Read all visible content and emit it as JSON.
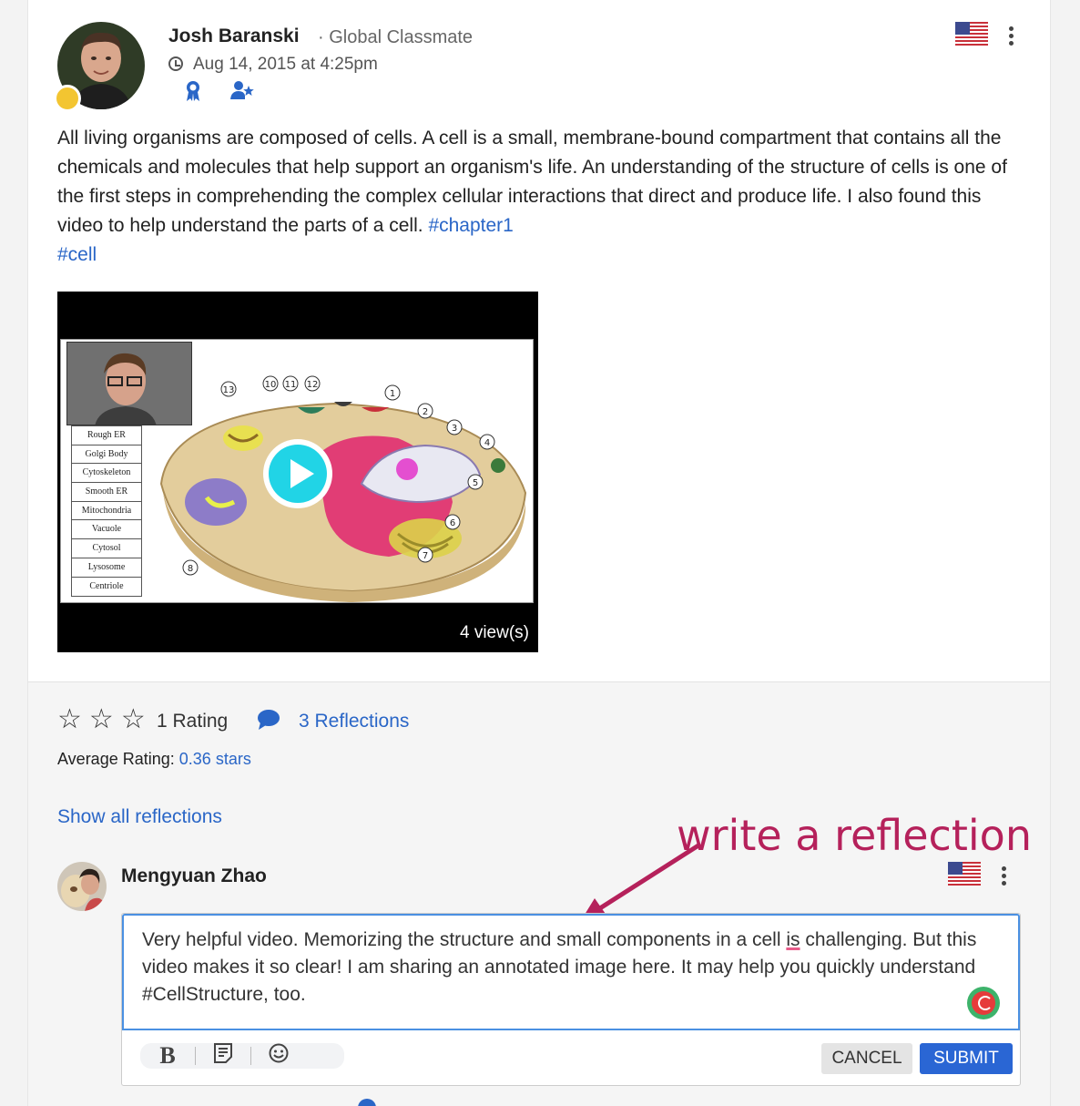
{
  "post": {
    "author": "Josh Baranski",
    "role": "· Global Classmate",
    "date": "Aug 14, 2015 at 4:25pm",
    "text": "All living organisms are composed of cells. A cell is a small, membrane-bound compartment that contains all the chemicals and molecules that help support an organism's life. An understanding of the structure of cells is one of the first steps in comprehending the complex cellular interactions that direct and produce life. I also found this video to help understand the parts of a cell. ",
    "hashtag1": "#chapter1",
    "hashtag2": "#cell",
    "video": {
      "views": "4 view(s)",
      "legend": [
        "Rough ER",
        "Golgi Body",
        "Cytoskeleton",
        "Smooth ER",
        "Mitochondria",
        "Vacuole",
        "Cytosol",
        "Lysosome",
        "Centriole"
      ],
      "numbers": [
        "1",
        "2",
        "3",
        "4",
        "5",
        "6",
        "7",
        "8",
        "10",
        "11",
        "12",
        "13"
      ]
    }
  },
  "engagement": {
    "rating_label": "1 Rating",
    "reflections_label": "3 Reflections",
    "average_label": "Average Rating:",
    "average_value": "0.36 stars",
    "show_all": "Show all reflections"
  },
  "annotation": "write a reflection",
  "composer": {
    "author": "Mengyuan Zhao",
    "text_before": "Very helpful video. Memorizing the structure and small components in a cell ",
    "text_flagged": "is",
    "text_after": " challenging. But this video makes it so clear! I am sharing an annotated image here. It may help you quickly understand #CellStructure, too.",
    "cancel": "CANCEL",
    "submit": "SUBMIT"
  },
  "colors": {
    "link": "#2a66c7",
    "annotation": "#b5215b",
    "submit": "#2a66d4",
    "status_dot": "#f3c531"
  },
  "icons": [
    "clock-icon",
    "ribbon-badge-icon",
    "user-star-icon",
    "us-flag-icon",
    "kebab-menu-icon",
    "star-icon",
    "chat-bubble-icon",
    "play-icon",
    "bold-icon",
    "note-icon",
    "emoji-icon",
    "grammar-check-icon"
  ]
}
